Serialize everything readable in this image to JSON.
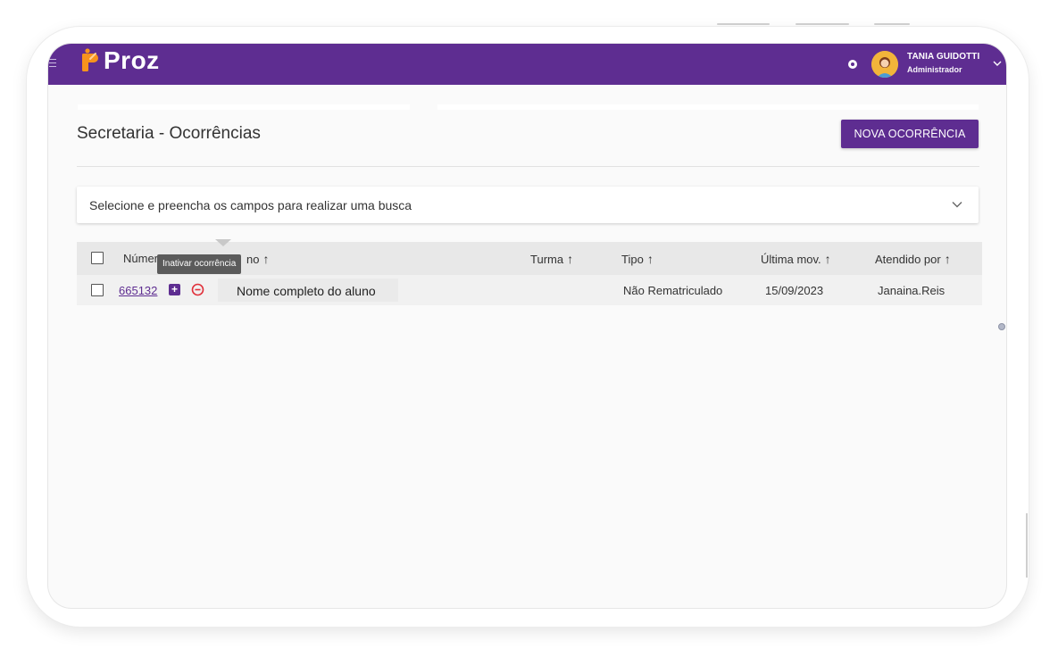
{
  "brand": {
    "name": "Proz",
    "accent_color": "#5e2d91"
  },
  "user": {
    "name": "TANIA GUIDOTTI",
    "role": "Administrador"
  },
  "page": {
    "title": "Secretaria - Ocorrências",
    "new_button_label": "NOVA OCORRÊNCIA"
  },
  "search": {
    "prompt": "Selecione e preencha os campos para realizar uma busca"
  },
  "table": {
    "columns": {
      "numero": "Númer",
      "aluno": "no",
      "turma": "Turma",
      "tipo": "Tipo",
      "ultima_mov": "Última mov.",
      "atendido_por": "Atendido por"
    },
    "sort_arrow": "↑",
    "rows": [
      {
        "numero": "665132",
        "aluno": "Nome completo do aluno",
        "turma": "",
        "tipo": "Não Rematriculado",
        "ultima_mov": "15/09/2023",
        "atendido_por": "Janaina.Reis"
      }
    ]
  },
  "tooltip": {
    "text": "Inativar ocorrência"
  },
  "icons": {
    "menu": "hamburger-icon",
    "notifications": "bell-icon",
    "user_menu": "chevron-down-icon",
    "expand_search": "chevron-down-icon",
    "add": "plus-square-icon",
    "deactivate": "minus-circle-icon"
  }
}
